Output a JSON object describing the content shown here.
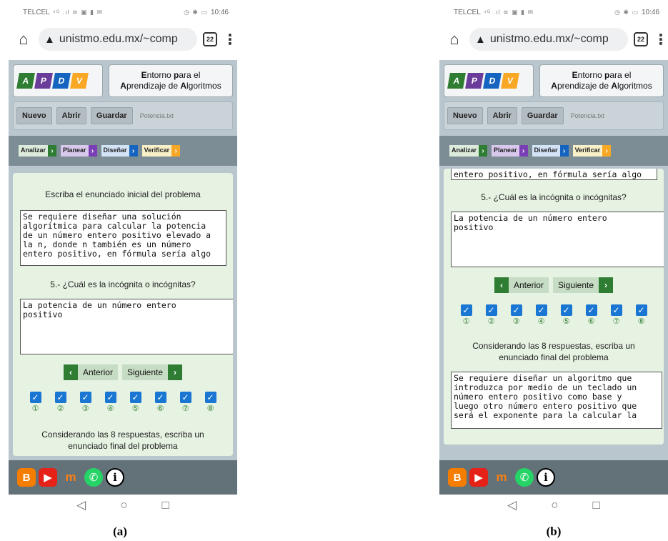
{
  "captions": {
    "a": "(a)",
    "b": "(b)"
  },
  "status": {
    "carrier": "TELCEL",
    "time": "10:46",
    "icons_left": "⁴ᴳ .ıl ≋ ▣ ▮ ✉",
    "icons_right": "◷ ✱ ▭"
  },
  "browser": {
    "home_icon": "⌂",
    "warning_icon": "▲",
    "url": "unistmo.edu.mx/~comp",
    "tabs_count": "22",
    "menu_icon": "⋮"
  },
  "app": {
    "logo_letters": [
      {
        "letter": "A",
        "color": "#2e7d32"
      },
      {
        "letter": "P",
        "color": "#6a3d9a"
      },
      {
        "letter": "D",
        "color": "#1565c0"
      },
      {
        "letter": "V",
        "color": "#f9a825"
      }
    ],
    "title_line1_parts": [
      "E",
      "ntorno ",
      "p",
      "ara el"
    ],
    "title_line2_parts": [
      "A",
      "prendizaje de ",
      "A",
      "lgoritmos"
    ],
    "title_line1": "Entorno para el",
    "title_line2": "Aprendizaje de Algoritmos",
    "file_buttons": {
      "new": "Nuevo",
      "open": "Abrir",
      "save": "Guardar"
    },
    "filename": "Potencia.txt",
    "steps": [
      {
        "label": "Analizar",
        "bg": "#dcebdc",
        "arrow_bg": "#2e7d32"
      },
      {
        "label": "Planear",
        "bg": "#d8c8ec",
        "arrow_bg": "#7b3fb5"
      },
      {
        "label": "Diseñar",
        "bg": "#d4e4f7",
        "arrow_bg": "#1565c0"
      },
      {
        "label": "Verificar",
        "bg": "#f7f0c8",
        "arrow_bg": "#f9a825"
      }
    ],
    "step_arrow": "›"
  },
  "screen_a": {
    "initial_label": "Escriba el enunciado inicial del problema",
    "initial_text": "Se requiere diseñar una solución\nalgorítmica para calcular la potencia\nde un número entero positivo elevado a\nla n, donde n también es un número\nentero positivo, en fórmula sería algo",
    "question_label": "5.- ¿Cuál es la incógnita o incógnitas?",
    "answer_text": "La potencia de un número entero\npositivo",
    "prev_label": "Anterior",
    "next_label": "Siguiente",
    "final_label_partial": "Considerando las 8 respuestas, escriba un",
    "final_label_cut": "enunciado final del problema"
  },
  "screen_b": {
    "top_cut_text": "entero positivo, en fórmula sería algo",
    "question_label": "5.- ¿Cuál es la incógnita o incógnitas?",
    "answer_text": "La potencia de un número entero\npositivo",
    "prev_label": "Anterior",
    "next_label": "Siguiente",
    "final_label": "Considerando las 8 respuestas, escriba un enunciado final del problema",
    "final_text": "Se requiere diseñar un algoritmo que\nintroduzca por medio de un teclado un\nnúmero entero positivo como base y\nluego otro número entero positivo que\nserá el exponente para la calcular la"
  },
  "checkboxes": {
    "checkmark": "✓",
    "numbers": [
      "①",
      "②",
      "③",
      "④",
      "⑤",
      "⑥",
      "⑦",
      "⑧"
    ],
    "checked": [
      true,
      true,
      true,
      true,
      true,
      true,
      true,
      true
    ]
  },
  "footer_icons": {
    "blogger": "B",
    "youtube": "▶",
    "moodle": "m",
    "whatsapp": "✆",
    "info": "i"
  },
  "android_nav": {
    "back": "◁",
    "home": "○",
    "recent": "□"
  }
}
